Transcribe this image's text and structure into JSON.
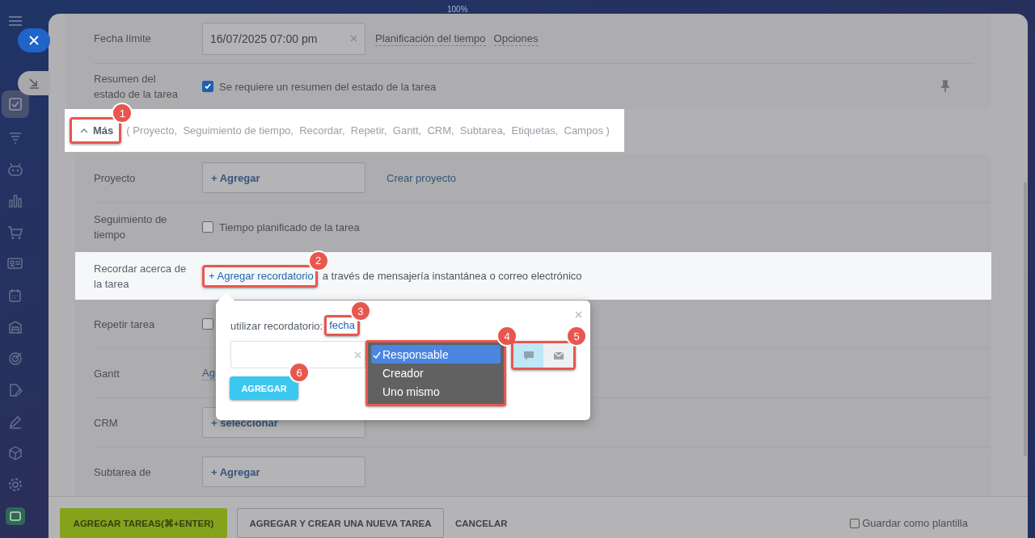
{
  "zoom_label": "100%",
  "sidebar": {
    "items": [
      {
        "kind": "tasks",
        "selected": true
      },
      {
        "kind": "funnel",
        "selected": false
      },
      {
        "kind": "robot",
        "selected": false
      },
      {
        "kind": "chart",
        "selected": false
      },
      {
        "kind": "cart",
        "selected": false
      },
      {
        "kind": "card",
        "selected": false
      },
      {
        "kind": "calendar",
        "selected": false
      },
      {
        "kind": "store",
        "selected": false
      },
      {
        "kind": "target",
        "selected": false
      },
      {
        "kind": "document",
        "selected": false
      },
      {
        "kind": "pen",
        "selected": false
      },
      {
        "kind": "cube",
        "selected": false
      },
      {
        "kind": "gear",
        "selected": false
      },
      {
        "kind": "app",
        "selected": false
      }
    ]
  },
  "deadline": {
    "label": "Fecha límite",
    "value": "16/07/2025 07:00 pm",
    "links": [
      "Planificación del tiempo",
      "Opciones"
    ]
  },
  "summary": {
    "label": "Resumen del estado de la tarea",
    "checked": true,
    "text": "Se requiere un resumen del estado de la tarea"
  },
  "more": {
    "label": "Más",
    "expanded": true,
    "badge": "1",
    "list": "( Proyecto,  Seguimiento de tiempo,  Recordar,  Repetir,  Gantt,  CRM,  Subtarea,  Etiquetas,  Campos )"
  },
  "rows": [
    {
      "kind": "add",
      "label": "Proyecto",
      "button": "+ Agregar",
      "link": "Crear proyecto"
    },
    {
      "kind": "checkbox",
      "label": "Seguimiento de tiempo",
      "checked": false,
      "text": "Tiempo planificado de la tarea"
    },
    {
      "kind": "reminder",
      "label": "Recordar acerca de la tarea",
      "link": "+ Agregar recordatorio",
      "badge": "2",
      "text": "a través de mensajería instantánea o correo electrónico"
    },
    {
      "kind": "checkbox",
      "label": "Repetir tarea",
      "checked": false
    },
    {
      "kind": "link",
      "label": "Gantt",
      "link": "Ag"
    },
    {
      "kind": "add",
      "label": "CRM",
      "button": "+ seleccionar"
    },
    {
      "kind": "add",
      "label": "Subtarea de",
      "button": "+ Agregar"
    }
  ],
  "popup": {
    "label": "utilizar recordatorio:",
    "link": "fecha",
    "link_badge": "3",
    "options": [
      {
        "label": "Responsable",
        "selected": true
      },
      {
        "label": "Creador",
        "selected": false
      },
      {
        "label": "Uno mismo",
        "selected": false
      }
    ],
    "options_badge": "4",
    "channels": [
      {
        "kind": "chat",
        "selected": true
      },
      {
        "kind": "mail",
        "selected": false
      }
    ],
    "channels_badge": "5",
    "button": "AGREGAR",
    "button_badge": "6"
  },
  "footer": {
    "primary": "AGREGAR TAREAS(⌘+ENTER)",
    "secondary": "AGREGAR Y CREAR UNA NUEVA TAREA",
    "cancel": "CANCELAR",
    "template": {
      "label": "Guardar como plantilla",
      "checked": false
    }
  }
}
